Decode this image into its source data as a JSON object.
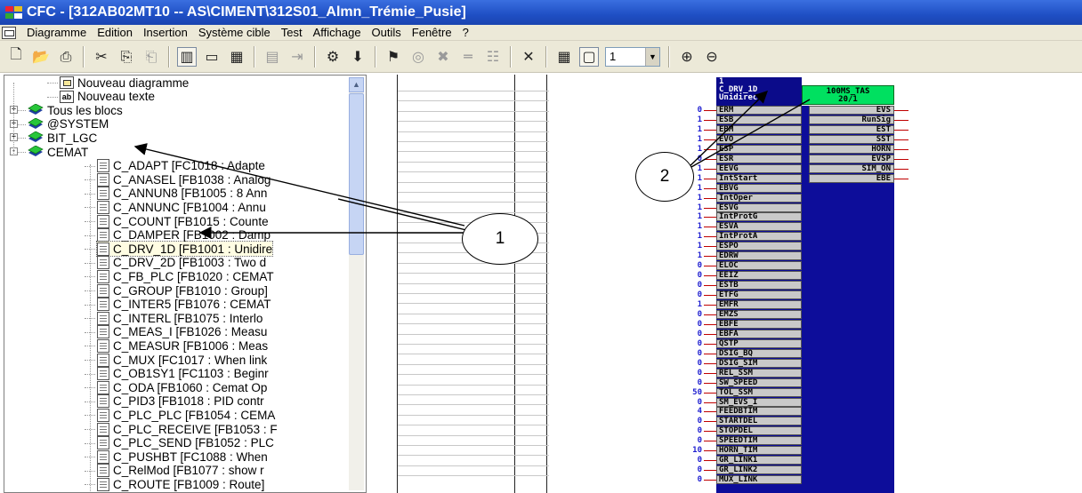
{
  "window": {
    "title": "CFC - [312AB02MT10 -- AS\\CIMENT\\312S01_Almn_Trémie_Pusie]"
  },
  "menu": [
    "Diagramme",
    "Edition",
    "Insertion",
    "Système cible",
    "Test",
    "Affichage",
    "Outils",
    "Fenêtre",
    "?"
  ],
  "toolbar": {
    "zoom_value": "1",
    "icons": [
      "new-icon",
      "open-icon",
      "print-icon",
      "cut-icon",
      "copy-icon",
      "paste-icon",
      "block-view-icon",
      "sheet-view-icon",
      "overview-icon",
      "run-sequence-icon",
      "next-icon",
      "compile-icon",
      "download-icon",
      "test-mode-icon",
      "watch-icon",
      "connection-icon",
      "line-icon",
      "trace-icon",
      "delete-connection-icon",
      "grid-icon",
      "sheet-icon",
      "zoom-in-icon",
      "zoom-out-icon"
    ]
  },
  "tree": {
    "items": [
      {
        "label": "Nouveau diagramme",
        "icon": "diagram-icon",
        "level": 1
      },
      {
        "label": "Nouveau texte",
        "icon": "text-icon",
        "level": 1
      },
      {
        "label": "Tous les blocs",
        "icon": "library-icon",
        "level": 0,
        "expander": "+"
      },
      {
        "label": "@SYSTEM",
        "icon": "library-icon",
        "level": 0,
        "expander": "+"
      },
      {
        "label": "BIT_LGC",
        "icon": "library-icon",
        "level": 0,
        "expander": "+"
      },
      {
        "label": "CEMAT",
        "icon": "library-icon",
        "level": 0,
        "expander": "-"
      },
      {
        "label": "C_ADAPT [FC1018 : Adapte",
        "icon": "block-icon",
        "level": 2
      },
      {
        "label": "C_ANASEL [FB1038 : Analog",
        "icon": "block-icon",
        "level": 2
      },
      {
        "label": "C_ANNUN8 [FB1005 : 8 Ann",
        "icon": "block-icon",
        "level": 2
      },
      {
        "label": "C_ANNUNC [FB1004 : Annu",
        "icon": "block-icon",
        "level": 2
      },
      {
        "label": "C_COUNT [FB1015 : Counte",
        "icon": "block-icon",
        "level": 2
      },
      {
        "label": "C_DAMPER [FB1002 : Damp",
        "icon": "block-icon",
        "level": 2
      },
      {
        "label": "C_DRV_1D [FB1001 : Unidire",
        "icon": "block-icon",
        "level": 2,
        "selected": true
      },
      {
        "label": "C_DRV_2D [FB1003 : Two d",
        "icon": "block-icon",
        "level": 2
      },
      {
        "label": "C_FB_PLC [FB1020 : CEMAT",
        "icon": "block-icon",
        "level": 2
      },
      {
        "label": "C_GROUP [FB1010 : Group]",
        "icon": "block-icon",
        "level": 2
      },
      {
        "label": "C_INTER5 [FB1076 : CEMAT",
        "icon": "block-icon",
        "level": 2
      },
      {
        "label": "C_INTERL [FB1075 : Interlo",
        "icon": "block-icon",
        "level": 2
      },
      {
        "label": "C_MEAS_I [FB1026 : Measu",
        "icon": "block-icon",
        "level": 2
      },
      {
        "label": "C_MEASUR [FB1006 : Meas",
        "icon": "block-icon",
        "level": 2
      },
      {
        "label": "C_MUX [FC1017 : When link",
        "icon": "block-icon",
        "level": 2
      },
      {
        "label": "C_OB1SY1 [FC1103 : Beginr",
        "icon": "block-icon",
        "level": 2
      },
      {
        "label": "C_ODA [FB1060 : Cemat Op",
        "icon": "block-icon",
        "level": 2
      },
      {
        "label": "C_PID3 [FB1018 : PID contr",
        "icon": "block-icon",
        "level": 2
      },
      {
        "label": "C_PLC_PLC [FB1054 : CEMA",
        "icon": "block-icon",
        "level": 2
      },
      {
        "label": "C_PLC_RECEIVE [FB1053 : F",
        "icon": "block-icon",
        "level": 2
      },
      {
        "label": "C_PLC_SEND [FB1052 : PLC",
        "icon": "block-icon",
        "level": 2
      },
      {
        "label": "C_PUSHBT [FC1088 : When",
        "icon": "block-icon",
        "level": 2
      },
      {
        "label": "C_RelMod [FB1077 : show r",
        "icon": "block-icon",
        "level": 2
      },
      {
        "label": "C_ROUTE [FB1009 : Route]",
        "icon": "block-icon",
        "level": 2
      }
    ]
  },
  "block": {
    "number": "1",
    "name": "C_DRV_1D",
    "comment": "Unidirec",
    "task": "100MS_TAS",
    "task_seq": "20/1",
    "inputs": [
      {
        "name": "ERM",
        "value": "0"
      },
      {
        "name": "ESB",
        "value": "1"
      },
      {
        "name": "EBM",
        "value": "1"
      },
      {
        "name": "EVO",
        "value": "1"
      },
      {
        "name": "ESP",
        "value": "1"
      },
      {
        "name": "ESR",
        "value": "0"
      },
      {
        "name": "EEVG",
        "value": "1"
      },
      {
        "name": "IntStart",
        "value": "1"
      },
      {
        "name": "EBVG",
        "value": "1"
      },
      {
        "name": "IntOper",
        "value": "1"
      },
      {
        "name": "ESVG",
        "value": "1"
      },
      {
        "name": "IntProtG",
        "value": "1"
      },
      {
        "name": "ESVA",
        "value": "1"
      },
      {
        "name": "IntProtA",
        "value": "1"
      },
      {
        "name": "ESPO",
        "value": "1"
      },
      {
        "name": "EDRW",
        "value": "1"
      },
      {
        "name": "ELOC",
        "value": "0"
      },
      {
        "name": "EEIZ",
        "value": "0"
      },
      {
        "name": "ESTB",
        "value": "0"
      },
      {
        "name": "ETFG",
        "value": "0"
      },
      {
        "name": "EMFR",
        "value": "1"
      },
      {
        "name": "EMZS",
        "value": "0"
      },
      {
        "name": "EBFE",
        "value": "0"
      },
      {
        "name": "EBFA",
        "value": "0"
      },
      {
        "name": "QSTP",
        "value": "0"
      },
      {
        "name": "DSIG_BQ",
        "value": "0"
      },
      {
        "name": "DSIG_SIM",
        "value": "0"
      },
      {
        "name": "REL_SSM",
        "value": "0"
      },
      {
        "name": "SW_SPEED",
        "value": "0"
      },
      {
        "name": "TOL_SSM",
        "value": "50"
      },
      {
        "name": "SM_EVS_I",
        "value": "0"
      },
      {
        "name": "FEEDBTIM",
        "value": "4"
      },
      {
        "name": "STARTDEL",
        "value": "0"
      },
      {
        "name": "STOPDEL",
        "value": "0"
      },
      {
        "name": "SPEEDTIM",
        "value": "0"
      },
      {
        "name": "HORN_TIM",
        "value": "10"
      },
      {
        "name": "GR_LINK1",
        "value": "0"
      },
      {
        "name": "GR_LINK2",
        "value": "0"
      },
      {
        "name": "MUX_LINK",
        "value": "0"
      }
    ],
    "outputs": [
      "EVS",
      "RunSig",
      "EST",
      "SST",
      "HORN",
      "EVSP",
      "SIM_ON",
      "EBE"
    ]
  },
  "annotations": {
    "callout1": "1",
    "callout2": "2"
  }
}
